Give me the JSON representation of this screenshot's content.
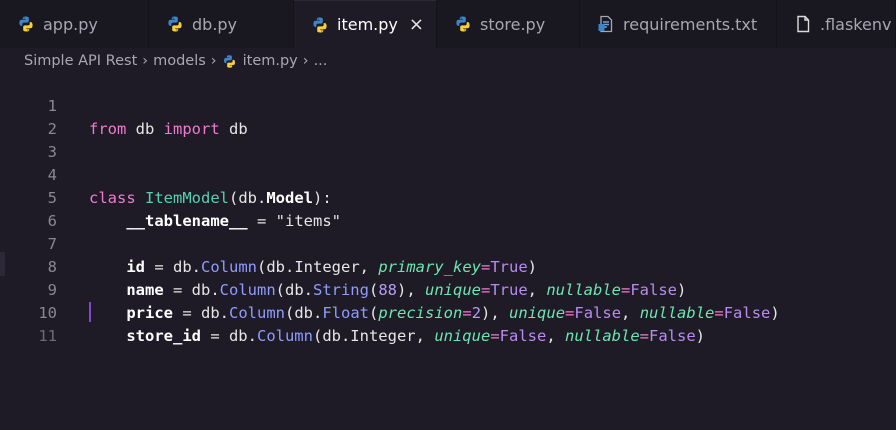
{
  "tabs": [
    {
      "label": "app.py",
      "icon": "python-icon",
      "active": false
    },
    {
      "label": "db.py",
      "icon": "python-icon",
      "active": false
    },
    {
      "label": "item.py",
      "icon": "python-icon",
      "active": true,
      "close": "×"
    },
    {
      "label": "store.py",
      "icon": "python-icon",
      "active": false
    },
    {
      "label": "requirements.txt",
      "icon": "text-file-icon",
      "active": false
    },
    {
      "label": ".flaskenv",
      "icon": "file-icon",
      "active": false
    }
  ],
  "breadcrumb": {
    "root": "Simple API Rest",
    "folder": "models",
    "file": "item.py",
    "more": "..."
  },
  "editor": {
    "line_numbers": [
      "1",
      "2",
      "3",
      "4",
      "5",
      "6",
      "7",
      "8",
      "9",
      "10",
      "11"
    ],
    "lines": {
      "l1": {
        "from": "from",
        "mod": " db ",
        "import": "import",
        "name": " db"
      },
      "l4": {
        "class": "class",
        "sp": " ",
        "cls": "ItemModel",
        "p1": "(db.",
        "model": "Model",
        "p2": "):"
      },
      "l5": {
        "indent": "    ",
        "attr": "__tablename__",
        "eq": " = ",
        "str": "\"items\""
      },
      "l7": {
        "indent": "    ",
        "name": "id",
        "eq": " = db.",
        "col": "Column",
        "p1": "(db.Integer, ",
        "k1": "primary_key",
        "e1": "=",
        "v1": "True",
        "end": ")"
      },
      "l8": {
        "indent": "    ",
        "name": "name",
        "eq": " = db.",
        "col": "Column",
        "p1": "(db.",
        "str": "String",
        "p2": "(",
        "n": "88",
        "p3": "), ",
        "k1": "unique",
        "e1": "=",
        "v1": "True",
        "c": ", ",
        "k2": "nullable",
        "e2": "=",
        "v2": "False",
        "end": ")"
      },
      "l9": {
        "indent": "    ",
        "name": "price",
        "eq": " = db.",
        "col": "Column",
        "p1": "(db.",
        "float": "Float",
        "p2": "(",
        "k0": "precision",
        "e0": "=",
        "n": "2",
        "p3": "), ",
        "k1": "unique",
        "e1": "=",
        "v1": "False",
        "c": ", ",
        "k2": "nullable",
        "e2": "=",
        "v2": "False",
        "end": ")"
      },
      "l10": {
        "indent": "    ",
        "name": "store_id",
        "eq": " = db.",
        "col": "Column",
        "p1": "(db.Integer, ",
        "k1": "unique",
        "e1": "=",
        "v1": "False",
        "c": ", ",
        "k2": "nullable",
        "e2": "=",
        "v2": "False",
        "end": ")"
      }
    }
  },
  "colors": {
    "background": "#1e1b26",
    "keyword": "#f07acf",
    "class_name": "#57d1b1",
    "function": "#8f9cff",
    "parameter": "#6ee6b0",
    "constant": "#b98bf0",
    "cursor": "#7f4cc9"
  }
}
